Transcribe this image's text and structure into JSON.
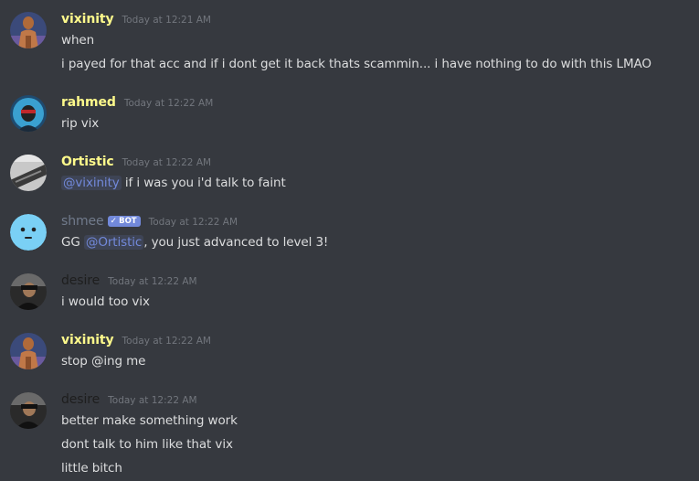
{
  "colors": {
    "background": "#36393f",
    "text": "#dcddde",
    "timestamp": "#72767d",
    "mention": "#7289da",
    "bot_tag": "#7289da",
    "name_yellow": "#fdf98b",
    "name_shmee": "#717b8c",
    "name_desire": "#1e1e1e"
  },
  "messages": [
    {
      "user": "vixinity",
      "timestamp": "Today at 12:21 AM",
      "lines": [
        {
          "text": "when"
        },
        {
          "text": "i payed for that acc and if i dont get it back thats scammin... i have nothing to do with this LMAO"
        }
      ]
    },
    {
      "user": "rahmed",
      "timestamp": "Today at 12:22 AM",
      "lines": [
        {
          "text": "rip vix"
        }
      ]
    },
    {
      "user": "Ortistic",
      "timestamp": "Today at 12:22 AM",
      "lines": [
        {
          "mention": "@vixinity",
          "text": " if i was you i'd talk to faint"
        }
      ]
    },
    {
      "user": "shmee",
      "bot_tag": "BOT",
      "bot_check": "✓",
      "timestamp": "Today at 12:22 AM",
      "lines": [
        {
          "pre": "GG ",
          "mention": "@Ortistic",
          "text": ", you just advanced to level 3!"
        }
      ]
    },
    {
      "user": "desire",
      "timestamp": "Today at 12:22 AM",
      "lines": [
        {
          "text": "i would too vix"
        }
      ]
    },
    {
      "user": "vixinity",
      "timestamp": "Today at 12:22 AM",
      "lines": [
        {
          "text": "stop @ing me"
        }
      ]
    },
    {
      "user": "desire",
      "timestamp": "Today at 12:22 AM",
      "lines": [
        {
          "text": "better make something work"
        },
        {
          "text": "dont talk to him like that vix"
        },
        {
          "text": "little bitch"
        }
      ]
    }
  ]
}
